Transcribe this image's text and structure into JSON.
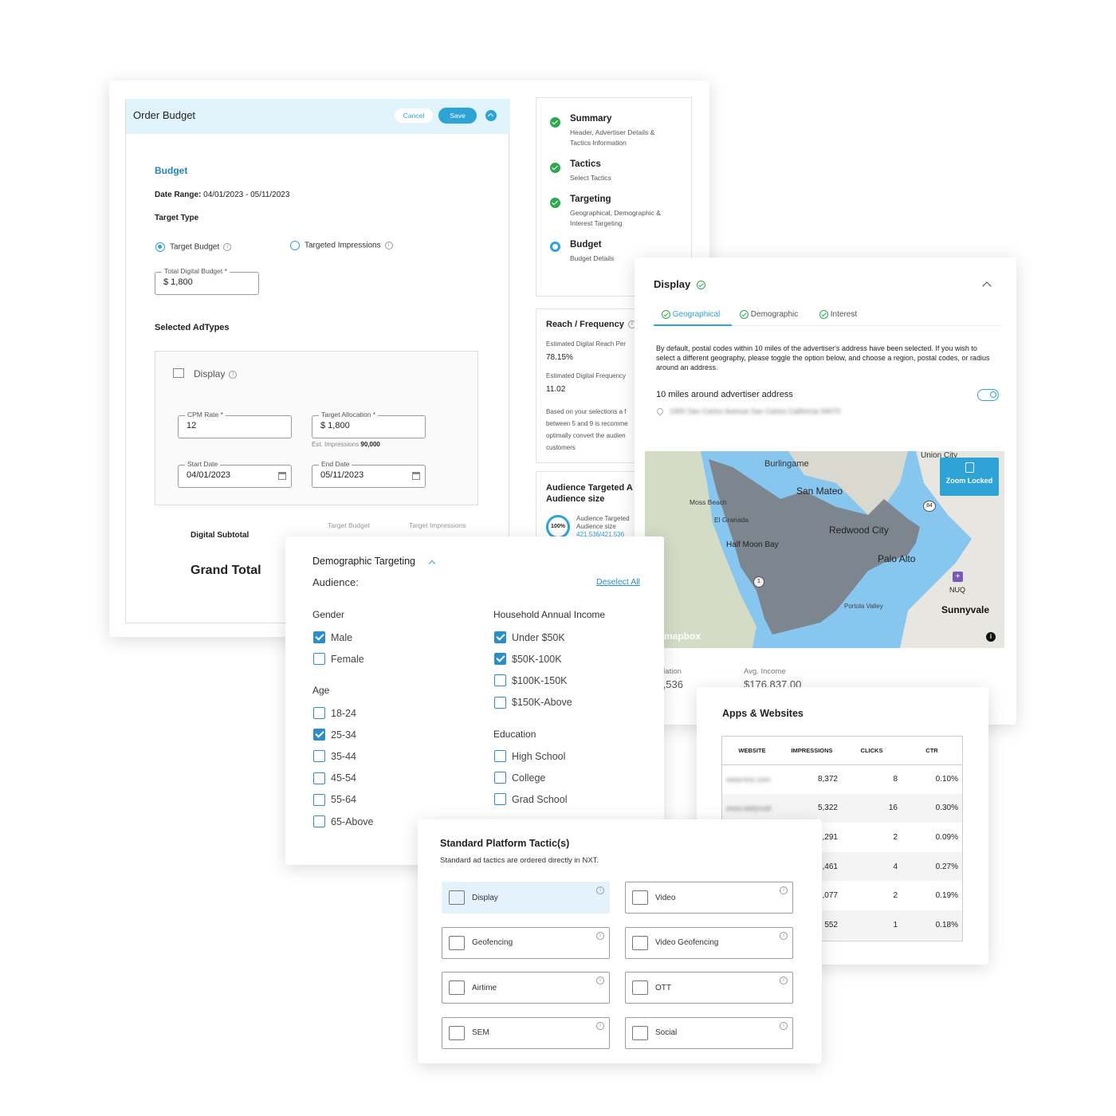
{
  "order_budget": {
    "title": "Order Budget",
    "cancel_label": "Cancel",
    "save_label": "Save",
    "budget_heading": "Budget",
    "date_range_label": "Date Range:",
    "date_range_value": "04/01/2023 - 05/11/2023",
    "target_type_label": "Target Type",
    "option_target_budget": "Target Budget",
    "option_targeted_impressions": "Targeted Impressions",
    "total_budget_label": "Total Digital Budget *",
    "total_budget_value": "$ 1,800",
    "selected_adtypes_label": "Selected AdTypes",
    "display_label": "Display",
    "cpm_label": "CPM Rate *",
    "cpm_value": "12",
    "target_alloc_label": "Target Allocation *",
    "target_alloc_value": "$  1,800",
    "est_impressions_label": "Est. Impressions",
    "est_impressions_value": "90,000",
    "start_date_label": "Start Date",
    "start_date_value": "04/01/2023",
    "end_date_label": "End Date",
    "end_date_value": "05/11/2023",
    "digital_subtotal_label": "Digital Subtotal",
    "col_target_budget": "Target Budget",
    "col_target_impressions": "Target Impressions",
    "grand_total_label": "Grand Total"
  },
  "steps": [
    {
      "title": "Summary",
      "desc": "Header, Advertiser Details & Tactics Information",
      "status": "done"
    },
    {
      "title": "Tactics",
      "desc": "Select Tactics",
      "status": "done"
    },
    {
      "title": "Targeting",
      "desc": "Geographical, Demographic & Interest Targeting",
      "status": "done"
    },
    {
      "title": "Budget",
      "desc": "Budget Details",
      "status": "current"
    }
  ],
  "reach": {
    "title": "Reach / Frequency",
    "reach_label": "Estimated Digital Reach Per",
    "reach_value": "78.15%",
    "freq_label": "Estimated Digital Frequency",
    "freq_value": "11.02",
    "note_lines": [
      "Based on your selections a f",
      "between 5 and 9 is recomme",
      "optimally convert the audien",
      "customers"
    ]
  },
  "audience": {
    "title_line1": "Audience Targeted A",
    "title_line2": "Audience size",
    "ring_value": "100%",
    "label1": "Audience Targeted",
    "label2": "Audience size",
    "value": "421,536/421,536"
  },
  "display_panel": {
    "title": "Display",
    "tabs": [
      "Geographical",
      "Demographic",
      "Interest"
    ],
    "description": "By default, postal codes within 10 miles of the advertiser's address have been selected. If you wish to select a different geography, please toggle the option below, and choose a region, postal codes, or radius around an address.",
    "radius_label": "10 miles around advertiser address",
    "address": "1900 San Carlos Avenue San Carlos California 94070",
    "map_labels": [
      "Burlingame",
      "Union City",
      "San Mateo",
      "Moss Beach",
      "El Granada",
      "Redwood City",
      "Half Moon Bay",
      "Palo Alto",
      "Portola Valley",
      "NUQ",
      "Sunnyvale",
      "84",
      "1"
    ],
    "zoom_locked_label": "Zoom Locked",
    "mapbox_label": "mapbox",
    "population_label": "Population",
    "population_value": "421,536",
    "avg_income_label": "Avg. Income",
    "avg_income_value": "$176,837.00"
  },
  "demographic": {
    "title": "Demographic Targeting",
    "audience_label": "Audience:",
    "deselect_all": "Deselect All",
    "gender_label": "Gender",
    "gender": [
      {
        "label": "Male",
        "checked": true
      },
      {
        "label": "Female",
        "checked": false
      }
    ],
    "age_label": "Age",
    "age": [
      {
        "label": "18-24",
        "checked": false
      },
      {
        "label": "25-34",
        "checked": true
      },
      {
        "label": "35-44",
        "checked": false
      },
      {
        "label": "45-54",
        "checked": false
      },
      {
        "label": "55-64",
        "checked": false
      },
      {
        "label": "65-Above",
        "checked": false
      }
    ],
    "income_label": "Household Annual Income",
    "income": [
      {
        "label": "Under $50K",
        "checked": true
      },
      {
        "label": "$50K-100K",
        "checked": true
      },
      {
        "label": "$100K-150K",
        "checked": false
      },
      {
        "label": "$150K-Above",
        "checked": false
      }
    ],
    "education_label": "Education",
    "education": [
      {
        "label": "High School",
        "checked": false
      },
      {
        "label": "College",
        "checked": false
      },
      {
        "label": "Grad School",
        "checked": false
      }
    ]
  },
  "apps": {
    "title": "Apps & Websites",
    "columns": [
      "WEBSITE",
      "IMPRESSIONS",
      "CLICKS",
      "CTR"
    ],
    "rows": [
      {
        "website": "www.tmz.com",
        "impressions": "8,372",
        "clicks": "8",
        "ctr": "0.10%"
      },
      {
        "website": "www.dailymail",
        "impressions": "5,322",
        "clicks": "16",
        "ctr": "0.30%"
      },
      {
        "website": "",
        "impressions": ",291",
        "clicks": "2",
        "ctr": "0.09%"
      },
      {
        "website": "",
        "impressions": ",461",
        "clicks": "4",
        "ctr": "0.27%"
      },
      {
        "website": "",
        "impressions": ",077",
        "clicks": "2",
        "ctr": "0.19%"
      },
      {
        "website": "",
        "impressions": "552",
        "clicks": "1",
        "ctr": "0.18%"
      }
    ]
  },
  "tactics": {
    "title": "Standard Platform Tactic(s)",
    "subtitle": "Standard ad tactics are ordered directly in NXT.",
    "items": [
      {
        "label": "Display",
        "icon": "billboard-icon",
        "selected": true
      },
      {
        "label": "Video",
        "icon": "video-icon",
        "selected": false
      },
      {
        "label": "Geofencing",
        "icon": "geofence-icon",
        "selected": false
      },
      {
        "label": "Video Geofencing",
        "icon": "video-geofence-icon",
        "selected": false
      },
      {
        "label": "Airtime",
        "icon": "radio-icon",
        "selected": false
      },
      {
        "label": "OTT",
        "icon": "tv-icon",
        "selected": false
      },
      {
        "label": "SEM",
        "icon": "search-icon",
        "selected": false
      },
      {
        "label": "Social",
        "icon": "social-icon",
        "selected": false
      }
    ]
  },
  "colors": {
    "accent": "#2ea3d6",
    "header_bg": "#e1f4fc",
    "success": "#2fa84f",
    "map_water": "#87c7ef",
    "map_region": "#7c7f86"
  }
}
